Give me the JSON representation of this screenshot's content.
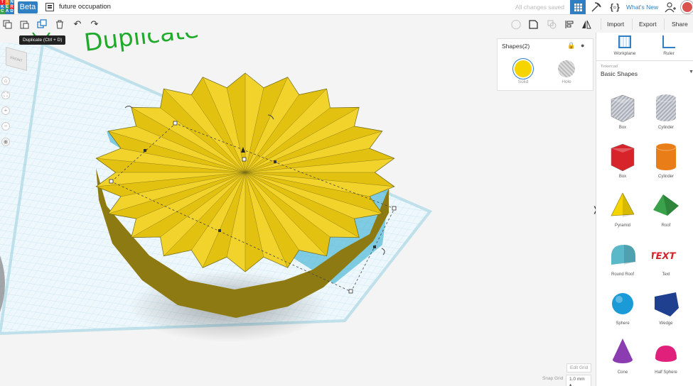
{
  "topbar": {
    "logo_letters": [
      "T",
      "I",
      "N",
      "K",
      "E",
      "R",
      "C",
      "A",
      "D"
    ],
    "beta_label": "Beta",
    "document_title": "future occupation",
    "save_status": "All changes saved",
    "whats_new": "What's New",
    "accent_color": "#2f7fc2"
  },
  "toolbar": {
    "tooltip": "Duplicate (Ctrl + D)",
    "annotation": "Duplicate",
    "import_label": "Import",
    "export_label": "Export",
    "share_label": "Share",
    "icons": [
      "copy-icon",
      "paste-icon",
      "duplicate-icon",
      "trash-icon",
      "undo-icon",
      "redo-icon",
      "light-bulb-icon",
      "note-icon",
      "group-icon",
      "align-icon",
      "mirror-icon"
    ]
  },
  "viewcube": {
    "label": "FRONT"
  },
  "shapes_panel": {
    "title": "Shapes(2)",
    "solid_label": "Solid",
    "hole_label": "Hole",
    "solid_color": "#f5d400"
  },
  "sidebar": {
    "workplane_label": "Workplane",
    "ruler_label": "Ruler",
    "library_provider": "Tinkercad",
    "library_name": "Basic Shapes",
    "shapes": [
      {
        "label": "Box",
        "color": "#b9bcc4",
        "style": "hole"
      },
      {
        "label": "Cylinder",
        "color": "#b9bcc4",
        "style": "hole"
      },
      {
        "label": "Box",
        "color": "#d7232a",
        "style": "solid"
      },
      {
        "label": "Cylinder",
        "color": "#e97d18",
        "style": "solid"
      },
      {
        "label": "Pyramid",
        "color": "#f5d400",
        "style": "solid"
      },
      {
        "label": "Roof",
        "color": "#3aa24a",
        "style": "solid"
      },
      {
        "label": "Round Roof",
        "color": "#5ab8c9",
        "style": "solid"
      },
      {
        "label": "Text",
        "color": "#d7232a",
        "style": "solid"
      },
      {
        "label": "Sphere",
        "color": "#1a9ad6",
        "style": "solid"
      },
      {
        "label": "Wedge",
        "color": "#1f3f8f",
        "style": "solid"
      },
      {
        "label": "Cone",
        "color": "#8a3cb0",
        "style": "solid"
      },
      {
        "label": "Half Sphere",
        "color": "#e0207a",
        "style": "solid"
      }
    ],
    "text_shape_word": "TEXT"
  },
  "grid": {
    "edit_grid_label": "Edit Grid",
    "snap_grid_label": "Snap Grid",
    "snap_grid_value": "1.0 mm"
  }
}
